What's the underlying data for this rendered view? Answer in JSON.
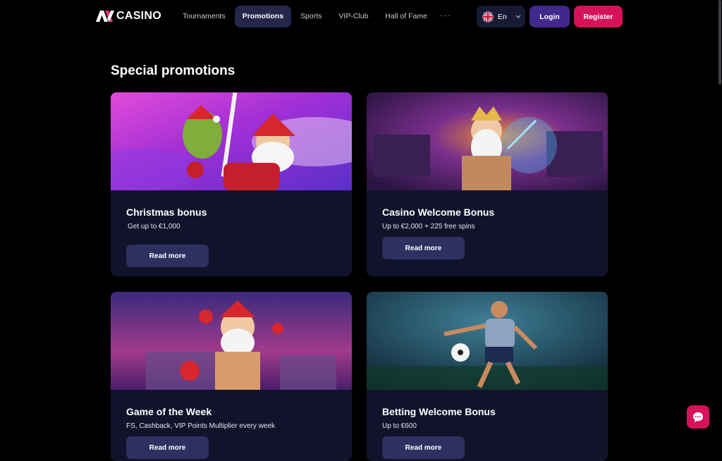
{
  "header": {
    "logo_text": "CASINO",
    "nav": [
      "Tournaments",
      "Promotions",
      "Sports",
      "VIP-Club",
      "Hall of Fame"
    ],
    "nav_more": "···",
    "language": "En",
    "login_label": "Login",
    "register_label": "Register"
  },
  "page_title": "Special promotions",
  "promotions": [
    {
      "title": "Christmas bonus",
      "subtitle": "Get up to €1,000",
      "button": "Read more"
    },
    {
      "title": "Casino Welcome Bonus",
      "subtitle": "Up to €2,000 + 225 free spins",
      "button": "Read more"
    },
    {
      "title": "Game of the Week",
      "subtitle": "FS, Cashback, VIP Points Multiplier every week",
      "button": "Read more"
    },
    {
      "title": "Betting Welcome Bonus",
      "subtitle": "Up to €600",
      "button": "Read more"
    }
  ],
  "colors": {
    "accent": "#d6135a",
    "login": "#41288c",
    "card_bg": "#11132b",
    "active_nav": "#25274a"
  },
  "icons": [
    "logo-mark-icon",
    "uk-flag-icon",
    "chevron-down-icon",
    "chat-bubble-icon"
  ]
}
